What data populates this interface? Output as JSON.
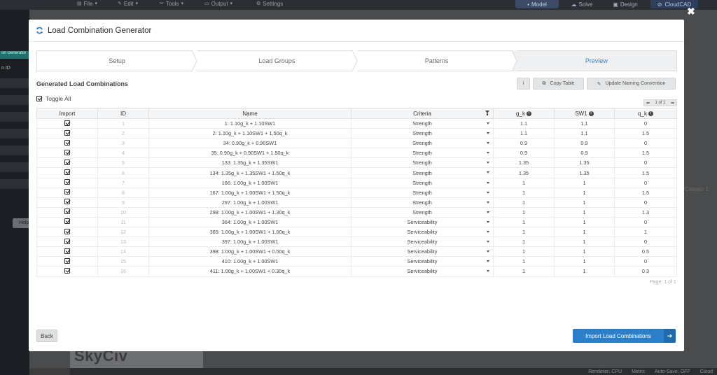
{
  "app": {
    "menus": [
      {
        "icon": "file-icon",
        "label": "File"
      },
      {
        "icon": "edit-icon",
        "label": "Edit"
      },
      {
        "icon": "tools-icon",
        "label": "Tools"
      },
      {
        "icon": "output-icon",
        "label": "Output"
      },
      {
        "icon": "settings-icon",
        "label": "Settings"
      }
    ],
    "modes": [
      "Model",
      "Solve",
      "Design"
    ],
    "active_mode": "Model",
    "cloud_label": "CloudCAD",
    "sidebar_label": "on Generator",
    "sidebar_id_label": "n ID",
    "help_label": "Help",
    "canvas_label": "Canvas 1",
    "logo": "SkyCiv",
    "status": [
      "Renderer: CPU",
      "Metric",
      "Auto-Save: OFF",
      "Cloud"
    ]
  },
  "modal": {
    "title": "Load Combination Generator",
    "close_glyph": "✖",
    "steps": [
      "Setup",
      "Load Groups",
      "Patterns",
      "Preview"
    ],
    "active_step": "Preview",
    "section_title": "Generated Load Combinations",
    "info_button": "i",
    "copy_table_label": "Copy Table",
    "update_naming_label": "Update Naming Convention",
    "toggle_all_label": "Toggle All",
    "pager": {
      "prev": "⬅",
      "text": "1 of 1",
      "next": "➡"
    },
    "columns": [
      "Import",
      "ID",
      "Name",
      "Criteria",
      "g_k",
      "SW1",
      "q_k"
    ],
    "rows": [
      {
        "id": "1",
        "name": "1: 1.10g_k + 1.10SW1",
        "criteria": "Strength",
        "g_k": "1.1",
        "sw1": "1.1",
        "q_k": "0"
      },
      {
        "id": "2",
        "name": "2: 1.10g_k + 1.10SW1 + 1.50q_k",
        "criteria": "Strength",
        "g_k": "1.1",
        "sw1": "1.1",
        "q_k": "1.5"
      },
      {
        "id": "3",
        "name": "34: 0.90g_k + 0.90SW1",
        "criteria": "Strength",
        "g_k": "0.9",
        "sw1": "0.9",
        "q_k": "0"
      },
      {
        "id": "4",
        "name": "35: 0.90g_k + 0.90SW1 + 1.50q_k",
        "criteria": "Strength",
        "g_k": "0.9",
        "sw1": "0.9",
        "q_k": "1.5"
      },
      {
        "id": "5",
        "name": "133: 1.35g_k + 1.35SW1",
        "criteria": "Strength",
        "g_k": "1.35",
        "sw1": "1.35",
        "q_k": "0"
      },
      {
        "id": "6",
        "name": "134: 1.35g_k + 1.35SW1 + 1.50q_k",
        "criteria": "Strength",
        "g_k": "1.35",
        "sw1": "1.35",
        "q_k": "1.5"
      },
      {
        "id": "7",
        "name": "166: 1.00g_k + 1.00SW1",
        "criteria": "Strength",
        "g_k": "1",
        "sw1": "1",
        "q_k": "0"
      },
      {
        "id": "8",
        "name": "167: 1.00g_k + 1.00SW1 + 1.50q_k",
        "criteria": "Strength",
        "g_k": "1",
        "sw1": "1",
        "q_k": "1.5"
      },
      {
        "id": "9",
        "name": "297: 1.00g_k + 1.00SW1",
        "criteria": "Strength",
        "g_k": "1",
        "sw1": "1",
        "q_k": "0"
      },
      {
        "id": "10",
        "name": "298: 1.00g_k + 1.00SW1 + 1.30q_k",
        "criteria": "Strength",
        "g_k": "1",
        "sw1": "1",
        "q_k": "1.3"
      },
      {
        "id": "11",
        "name": "364: 1.00g_k + 1.00SW1",
        "criteria": "Serviceability",
        "g_k": "1",
        "sw1": "1",
        "q_k": "0"
      },
      {
        "id": "12",
        "name": "365: 1.00g_k + 1.00SW1 + 1.00q_k",
        "criteria": "Serviceability",
        "g_k": "1",
        "sw1": "1",
        "q_k": "1"
      },
      {
        "id": "13",
        "name": "397: 1.00g_k + 1.00SW1",
        "criteria": "Serviceability",
        "g_k": "1",
        "sw1": "1",
        "q_k": "0"
      },
      {
        "id": "14",
        "name": "398: 1.00g_k + 1.00SW1 + 0.50q_k",
        "criteria": "Serviceability",
        "g_k": "1",
        "sw1": "1",
        "q_k": "0.5"
      },
      {
        "id": "15",
        "name": "410: 1.00g_k + 1.00SW1",
        "criteria": "Serviceability",
        "g_k": "1",
        "sw1": "1",
        "q_k": "0"
      },
      {
        "id": "16",
        "name": "411: 1.00g_k + 1.00SW1 + 0.30q_k",
        "criteria": "Serviceability",
        "g_k": "1",
        "sw1": "1",
        "q_k": "0.3"
      }
    ],
    "page_info": "Page: 1 of 1",
    "back_label": "Back",
    "import_label": "Import Load Combinations"
  }
}
